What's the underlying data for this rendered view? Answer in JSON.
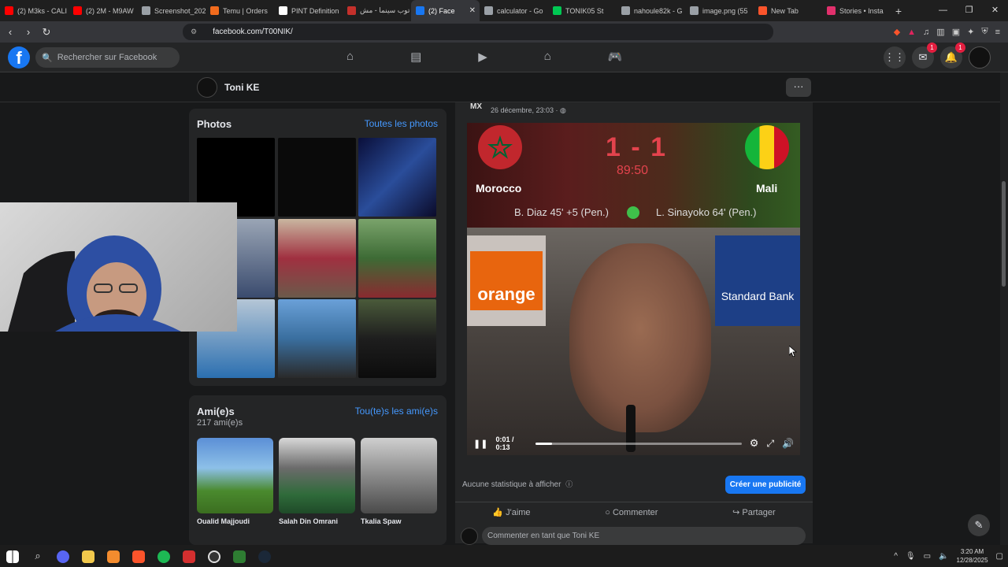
{
  "browser": {
    "tabs": [
      {
        "title": "(2) M3ks - CALI",
        "color": "#ff0000"
      },
      {
        "title": "(2) 2M - M9AW",
        "color": "#ff0000"
      },
      {
        "title": "Screenshot_202",
        "color": "#9aa0a6"
      },
      {
        "title": "Temu | Orders",
        "color": "#f26b1d"
      },
      {
        "title": "PINT Definition",
        "color": "#ffffff"
      },
      {
        "title": "توب سينما - مش",
        "color": "#c4302b"
      },
      {
        "title": "(2) Face",
        "color": "#1877f2",
        "active": true
      },
      {
        "title": "calculator - Go",
        "color": "#9aa0a6"
      },
      {
        "title": "TONIK05 St",
        "color": "#00c853"
      },
      {
        "title": "nahoule82k - G",
        "color": "#9aa0a6"
      },
      {
        "title": "image.png (55",
        "color": "#9aa0a6"
      },
      {
        "title": "New Tab",
        "color": "#fb542b"
      },
      {
        "title": "Stories • Insta",
        "color": "#e1306c"
      }
    ],
    "url": "facebook.com/T00NIK/"
  },
  "facebook": {
    "search_placeholder": "Rechercher sur Facebook",
    "messenger_badge": "1",
    "notifications_badge": "1"
  },
  "profile": {
    "name": "Toni KE",
    "more": "···"
  },
  "photos": {
    "title": "Photos",
    "link": "Toutes les photos"
  },
  "friends": {
    "title": "Ami(e)s",
    "count": "217 ami(e)s",
    "link": "Tou(te)s les ami(e)s",
    "items": [
      {
        "name": "Oualid Majjoudi"
      },
      {
        "name": "Salah Din Omrani"
      },
      {
        "name": "Tkalia Spaw"
      }
    ]
  },
  "post": {
    "page_logo": "MX",
    "timestamp": "26 décembre, 23:03 · ◍",
    "match": {
      "home": "Morocco",
      "away": "Mali",
      "score": "1 - 1",
      "clock": "89:50",
      "home_scorer": "B. Diaz 45' +5 (Pen.)",
      "away_scorer": "L. Sinayoko 64' (Pen.)"
    },
    "sponsor_left": "orange",
    "sponsor_right": "Standard Bank",
    "video_time": "0:01 / 0:13",
    "video_progress": 0.077,
    "stats_text": "Aucune statistique à afficher",
    "ad_button": "Créer une publicité",
    "like": "J'aime",
    "comment": "Commenter",
    "share": "Partager",
    "comment_placeholder": "Commenter en tant que Toni KE"
  },
  "taskbar": {
    "time": "3:20 AM",
    "date": "12/28/2025"
  }
}
